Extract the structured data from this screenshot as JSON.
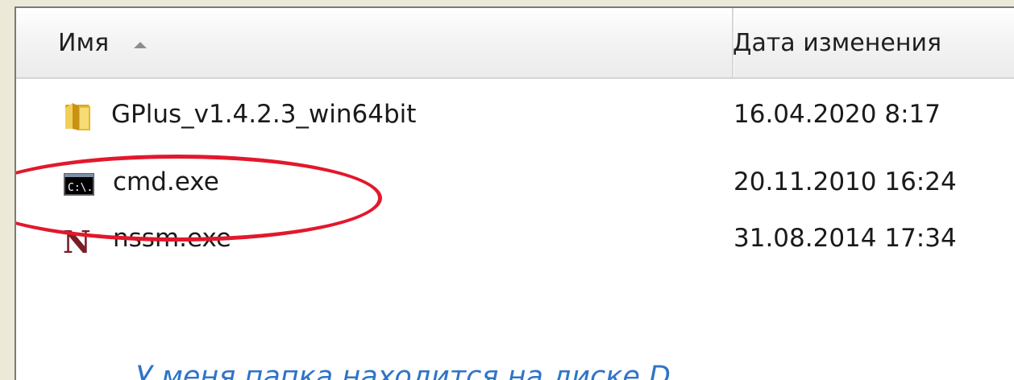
{
  "header": {
    "name_label": "Имя",
    "date_label": "Дата изменения"
  },
  "files": [
    {
      "name": "GPlus_v1.4.2.3_win64bit",
      "date": "16.04.2020 8:17",
      "icon": "folder-icon"
    },
    {
      "name": "cmd.exe",
      "date": "20.11.2010 16:24",
      "icon": "console-icon"
    },
    {
      "name": "nssm.exe",
      "date": "31.08.2014 17:34",
      "icon": "nssm-icon"
    }
  ],
  "annotation": {
    "caption": "У меня папка находится на диске D",
    "highlight_color": "#e2182c",
    "caption_color": "#2f74c8"
  }
}
